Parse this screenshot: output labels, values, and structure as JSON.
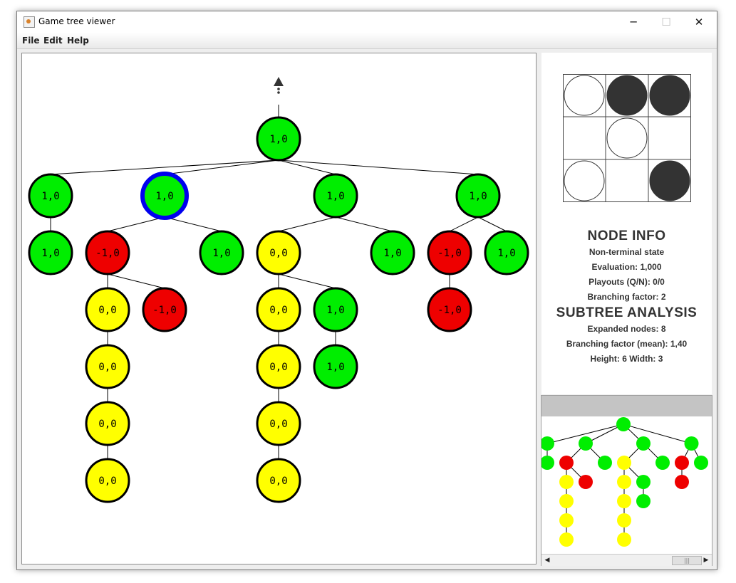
{
  "window": {
    "title": "Game tree viewer",
    "minimize_glyph": "─",
    "maximize_glyph": "☐",
    "close_glyph": "✕"
  },
  "menu": [
    "File",
    "Edit",
    "Help"
  ],
  "colors": {
    "win": "#00ee00",
    "loss": "#ee0000",
    "draw": "#ffff00",
    "selected_ring": "#0000ee",
    "stone_black": "#333333",
    "stone_white": "#ffffff"
  },
  "board": {
    "cells": [
      [
        "white",
        "black",
        "black"
      ],
      [
        "empty",
        "white",
        "empty"
      ],
      [
        "white",
        "empty",
        "black"
      ]
    ]
  },
  "node_info": {
    "title": "NODE INFO",
    "state": "Non-terminal state",
    "evaluation": "Evaluation: 1,000",
    "playouts": "Playouts (Q/N): 0/0",
    "branching": "Branching factor: 2"
  },
  "subtree_analysis": {
    "title": "SUBTREE ANALYSIS",
    "expanded": "Expanded nodes: 8",
    "branching_mean": "Branching factor (mean): 1,40",
    "height_width": "Height: 6   Width: 3"
  },
  "tree": {
    "root": {
      "label": "1,0",
      "type": "win"
    },
    "nodes": [
      {
        "id": "a",
        "parent": "root",
        "label": "1,0",
        "type": "win"
      },
      {
        "id": "b",
        "parent": "root",
        "label": "1,0",
        "type": "win",
        "selected": true
      },
      {
        "id": "c",
        "parent": "root",
        "label": "1,0",
        "type": "win"
      },
      {
        "id": "d",
        "parent": "root",
        "label": "1,0",
        "type": "win"
      },
      {
        "id": "a1",
        "parent": "a",
        "label": "1,0",
        "type": "win"
      },
      {
        "id": "b1",
        "parent": "b",
        "label": "-1,0",
        "type": "loss"
      },
      {
        "id": "b2",
        "parent": "b",
        "label": "1,0",
        "type": "win"
      },
      {
        "id": "c1",
        "parent": "c",
        "label": "0,0",
        "type": "draw"
      },
      {
        "id": "c2",
        "parent": "c",
        "label": "1,0",
        "type": "win"
      },
      {
        "id": "d1",
        "parent": "d",
        "label": "-1,0",
        "type": "loss"
      },
      {
        "id": "d2",
        "parent": "d",
        "label": "1,0",
        "type": "win"
      },
      {
        "id": "b1a",
        "parent": "b1",
        "label": "0,0",
        "type": "draw"
      },
      {
        "id": "b1b",
        "parent": "b1",
        "label": "-1,0",
        "type": "loss"
      },
      {
        "id": "c1a",
        "parent": "c1",
        "label": "0,0",
        "type": "draw"
      },
      {
        "id": "c1b",
        "parent": "c1",
        "label": "1,0",
        "type": "win"
      },
      {
        "id": "d1a",
        "parent": "d1",
        "label": "-1,0",
        "type": "loss"
      },
      {
        "id": "b1a1",
        "parent": "b1a",
        "label": "0,0",
        "type": "draw"
      },
      {
        "id": "c1a1",
        "parent": "c1a",
        "label": "0,0",
        "type": "draw"
      },
      {
        "id": "c1b1",
        "parent": "c1b",
        "label": "1,0",
        "type": "win"
      },
      {
        "id": "b1a2",
        "parent": "b1a1",
        "label": "0,0",
        "type": "draw"
      },
      {
        "id": "c1a2",
        "parent": "c1a1",
        "label": "0,0",
        "type": "draw"
      },
      {
        "id": "b1a3",
        "parent": "b1a2",
        "label": "0,0",
        "type": "draw"
      },
      {
        "id": "c1a3",
        "parent": "c1a2",
        "label": "0,0",
        "type": "draw"
      }
    ]
  },
  "minimap": {
    "scroll_left": "◀",
    "scroll_right": "▶",
    "thumb_grip": "|||"
  }
}
